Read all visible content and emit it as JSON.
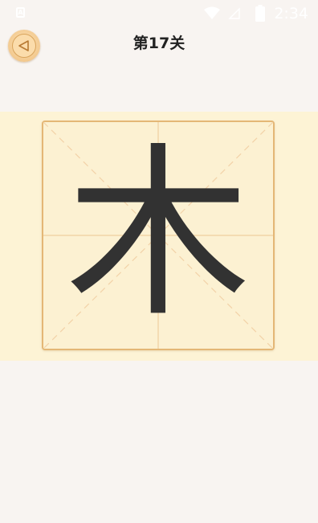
{
  "status_bar": {
    "notification_letter": "A",
    "time": "2:34",
    "icons": [
      "wifi-icon",
      "signal-icon",
      "battery-icon"
    ]
  },
  "header": {
    "back_icon": "back-arrow-icon",
    "title": "第17关"
  },
  "practice": {
    "character": "木",
    "colors": {
      "band": "#fdf3d5",
      "grid_border": "#e4b776",
      "guide_line": "#f0cfa0",
      "ink": "#323232"
    }
  }
}
